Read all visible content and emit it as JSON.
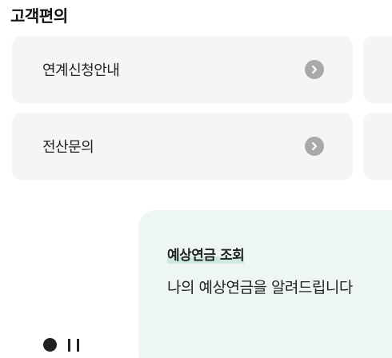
{
  "section": {
    "title": "고객편의"
  },
  "cards": [
    {
      "label": "연계신청안내",
      "icon": "chevron-right-circle-icon"
    },
    {
      "label": "전산문의",
      "icon": "chevron-right-circle-icon"
    }
  ],
  "banner": {
    "title": "예상연금 조회",
    "description": "나의 예상연금을 알려드립니다"
  },
  "carousel": {
    "active_indicator": "●",
    "pause_icon": "pause-icon"
  },
  "colors": {
    "card_bg": "#f5f5f5",
    "banner_bg": "#eef6f4",
    "arrow_bg": "#a9a9a9",
    "highlight": "#cfe9e2"
  }
}
